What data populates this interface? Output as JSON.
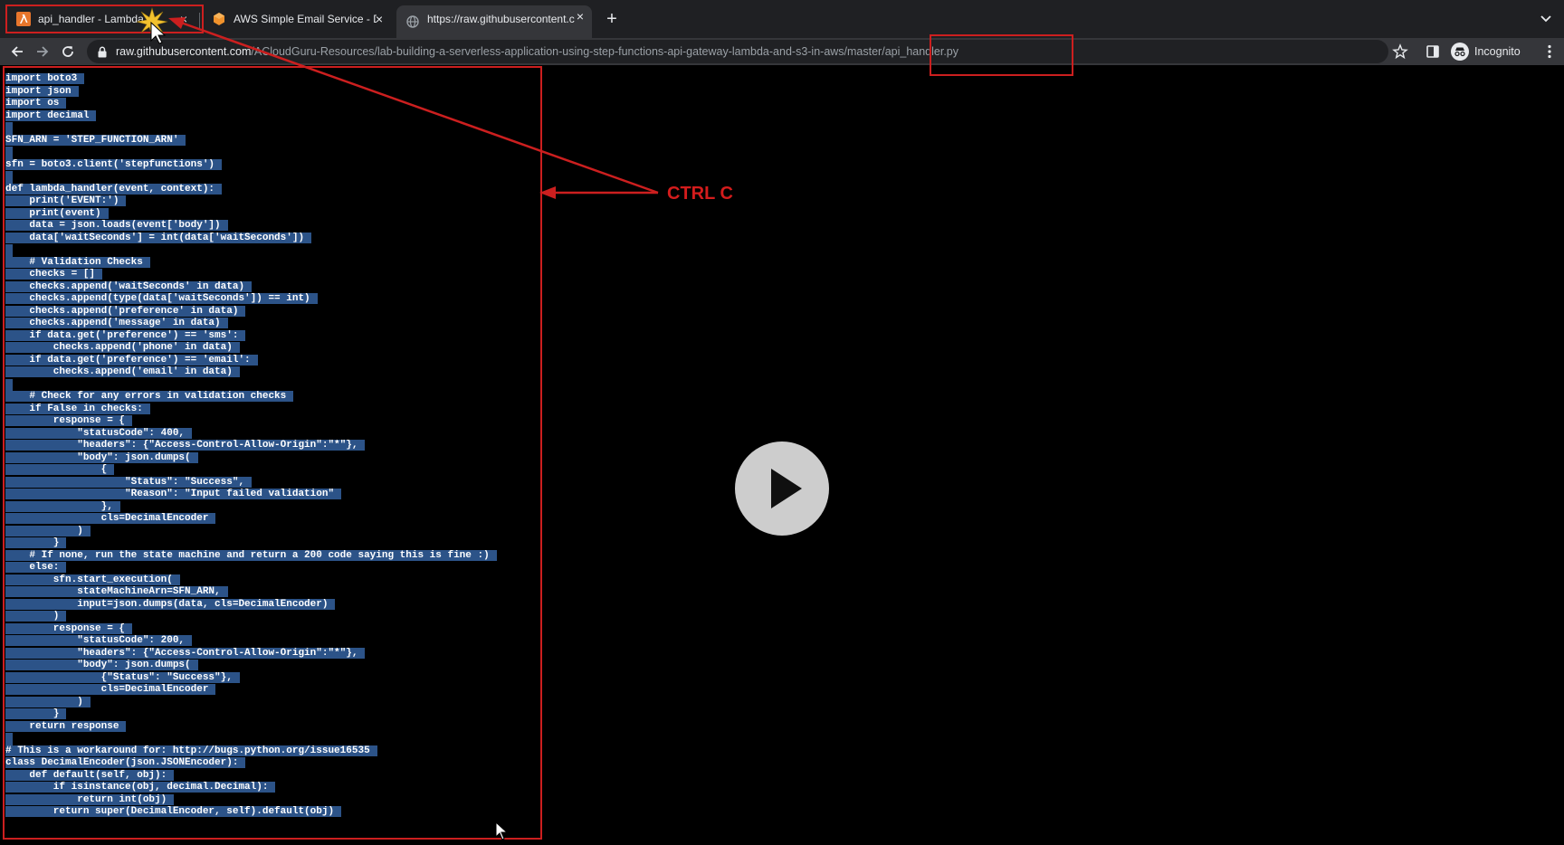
{
  "tabs": [
    {
      "title": "api_handler - Lambda",
      "favicon": "aws-lambda-icon",
      "close": "×"
    },
    {
      "title": "AWS Simple Email Service - De",
      "favicon": "aws-ses-icon",
      "close": "×"
    },
    {
      "title": "https://raw.githubusercontent.c",
      "favicon": "globe-icon",
      "close": "×",
      "active": true
    }
  ],
  "new_tab_label": "+",
  "address_bar": {
    "host": "raw.githubusercontent.com",
    "path": "/ACloudGuru-Resources/lab-building-a-serverless-application-using-step-functions-api-gateway-lambda-and-s3-in-aws/master/api_handler.py"
  },
  "incognito_label": "Incognito",
  "annotation": {
    "label": "CTRL C",
    "color": "#d41c1c"
  },
  "code_lines": [
    "import boto3",
    "import json",
    "import os",
    "import decimal",
    "",
    "SFN_ARN = 'STEP_FUNCTION_ARN'",
    "",
    "sfn = boto3.client('stepfunctions')",
    "",
    "def lambda_handler(event, context):",
    "    print('EVENT:')",
    "    print(event)",
    "    data = json.loads(event['body'])",
    "    data['waitSeconds'] = int(data['waitSeconds'])",
    "",
    "    # Validation Checks",
    "    checks = []",
    "    checks.append('waitSeconds' in data)",
    "    checks.append(type(data['waitSeconds']) == int)",
    "    checks.append('preference' in data)",
    "    checks.append('message' in data)",
    "    if data.get('preference') == 'sms':",
    "        checks.append('phone' in data)",
    "    if data.get('preference') == 'email':",
    "        checks.append('email' in data)",
    "",
    "    # Check for any errors in validation checks",
    "    if False in checks:",
    "        response = {",
    "            \"statusCode\": 400,",
    "            \"headers\": {\"Access-Control-Allow-Origin\":\"*\"},",
    "            \"body\": json.dumps(",
    "                {",
    "                    \"Status\": \"Success\",",
    "                    \"Reason\": \"Input failed validation\"",
    "                },",
    "                cls=DecimalEncoder",
    "            )",
    "        }",
    "    # If none, run the state machine and return a 200 code saying this is fine :)",
    "    else:",
    "        sfn.start_execution(",
    "            stateMachineArn=SFN_ARN,",
    "            input=json.dumps(data, cls=DecimalEncoder)",
    "        )",
    "        response = {",
    "            \"statusCode\": 200,",
    "            \"headers\": {\"Access-Control-Allow-Origin\":\"*\"},",
    "            \"body\": json.dumps(",
    "                {\"Status\": \"Success\"},",
    "                cls=DecimalEncoder",
    "            )",
    "        }",
    "    return response",
    "",
    "# This is a workaround for: http://bugs.python.org/issue16535",
    "class DecimalEncoder(json.JSONEncoder):",
    "    def default(self, obj):",
    "        if isinstance(obj, decimal.Decimal):",
    "            return int(obj)",
    "        return super(DecimalEncoder, self).default(obj)"
  ]
}
